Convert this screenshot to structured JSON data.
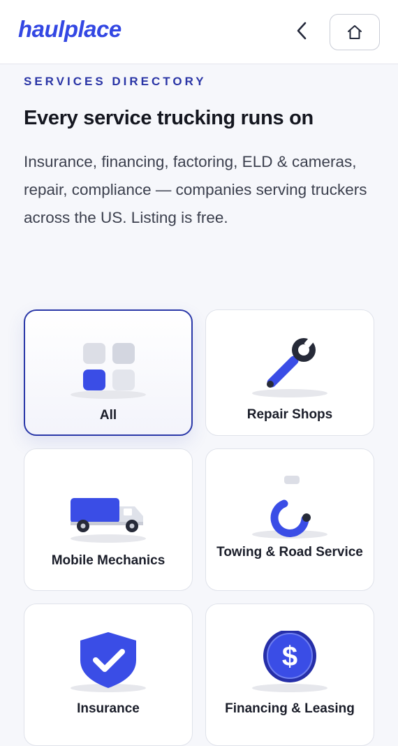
{
  "header": {
    "logo": "haulplace",
    "back_icon": "chevron-left-icon",
    "home_icon": "home-icon"
  },
  "intro": {
    "eyebrow": "SERVICES DIRECTORY",
    "title": "Every service trucking runs on",
    "description": "Insurance, financing, factoring, ELD & cameras, repair, compliance — companies serving truckers across the US. Listing is free."
  },
  "categories": [
    {
      "label": "All",
      "icon": "grid-icon",
      "selected": true
    },
    {
      "label": "Repair Shops",
      "icon": "wrench-icon",
      "selected": false
    },
    {
      "label": "Mobile Mechanics",
      "icon": "truck-icon",
      "selected": false
    },
    {
      "label": "Towing & Road Service",
      "icon": "tow-hook-icon",
      "selected": false
    },
    {
      "label": "Insurance",
      "icon": "shield-check-icon",
      "selected": false
    },
    {
      "label": "Financing & Leasing",
      "icon": "dollar-coin-icon",
      "selected": false
    }
  ],
  "colors": {
    "brand": "#3347e3",
    "accent_dark": "#2a38a8",
    "background": "#f6f7fb"
  }
}
